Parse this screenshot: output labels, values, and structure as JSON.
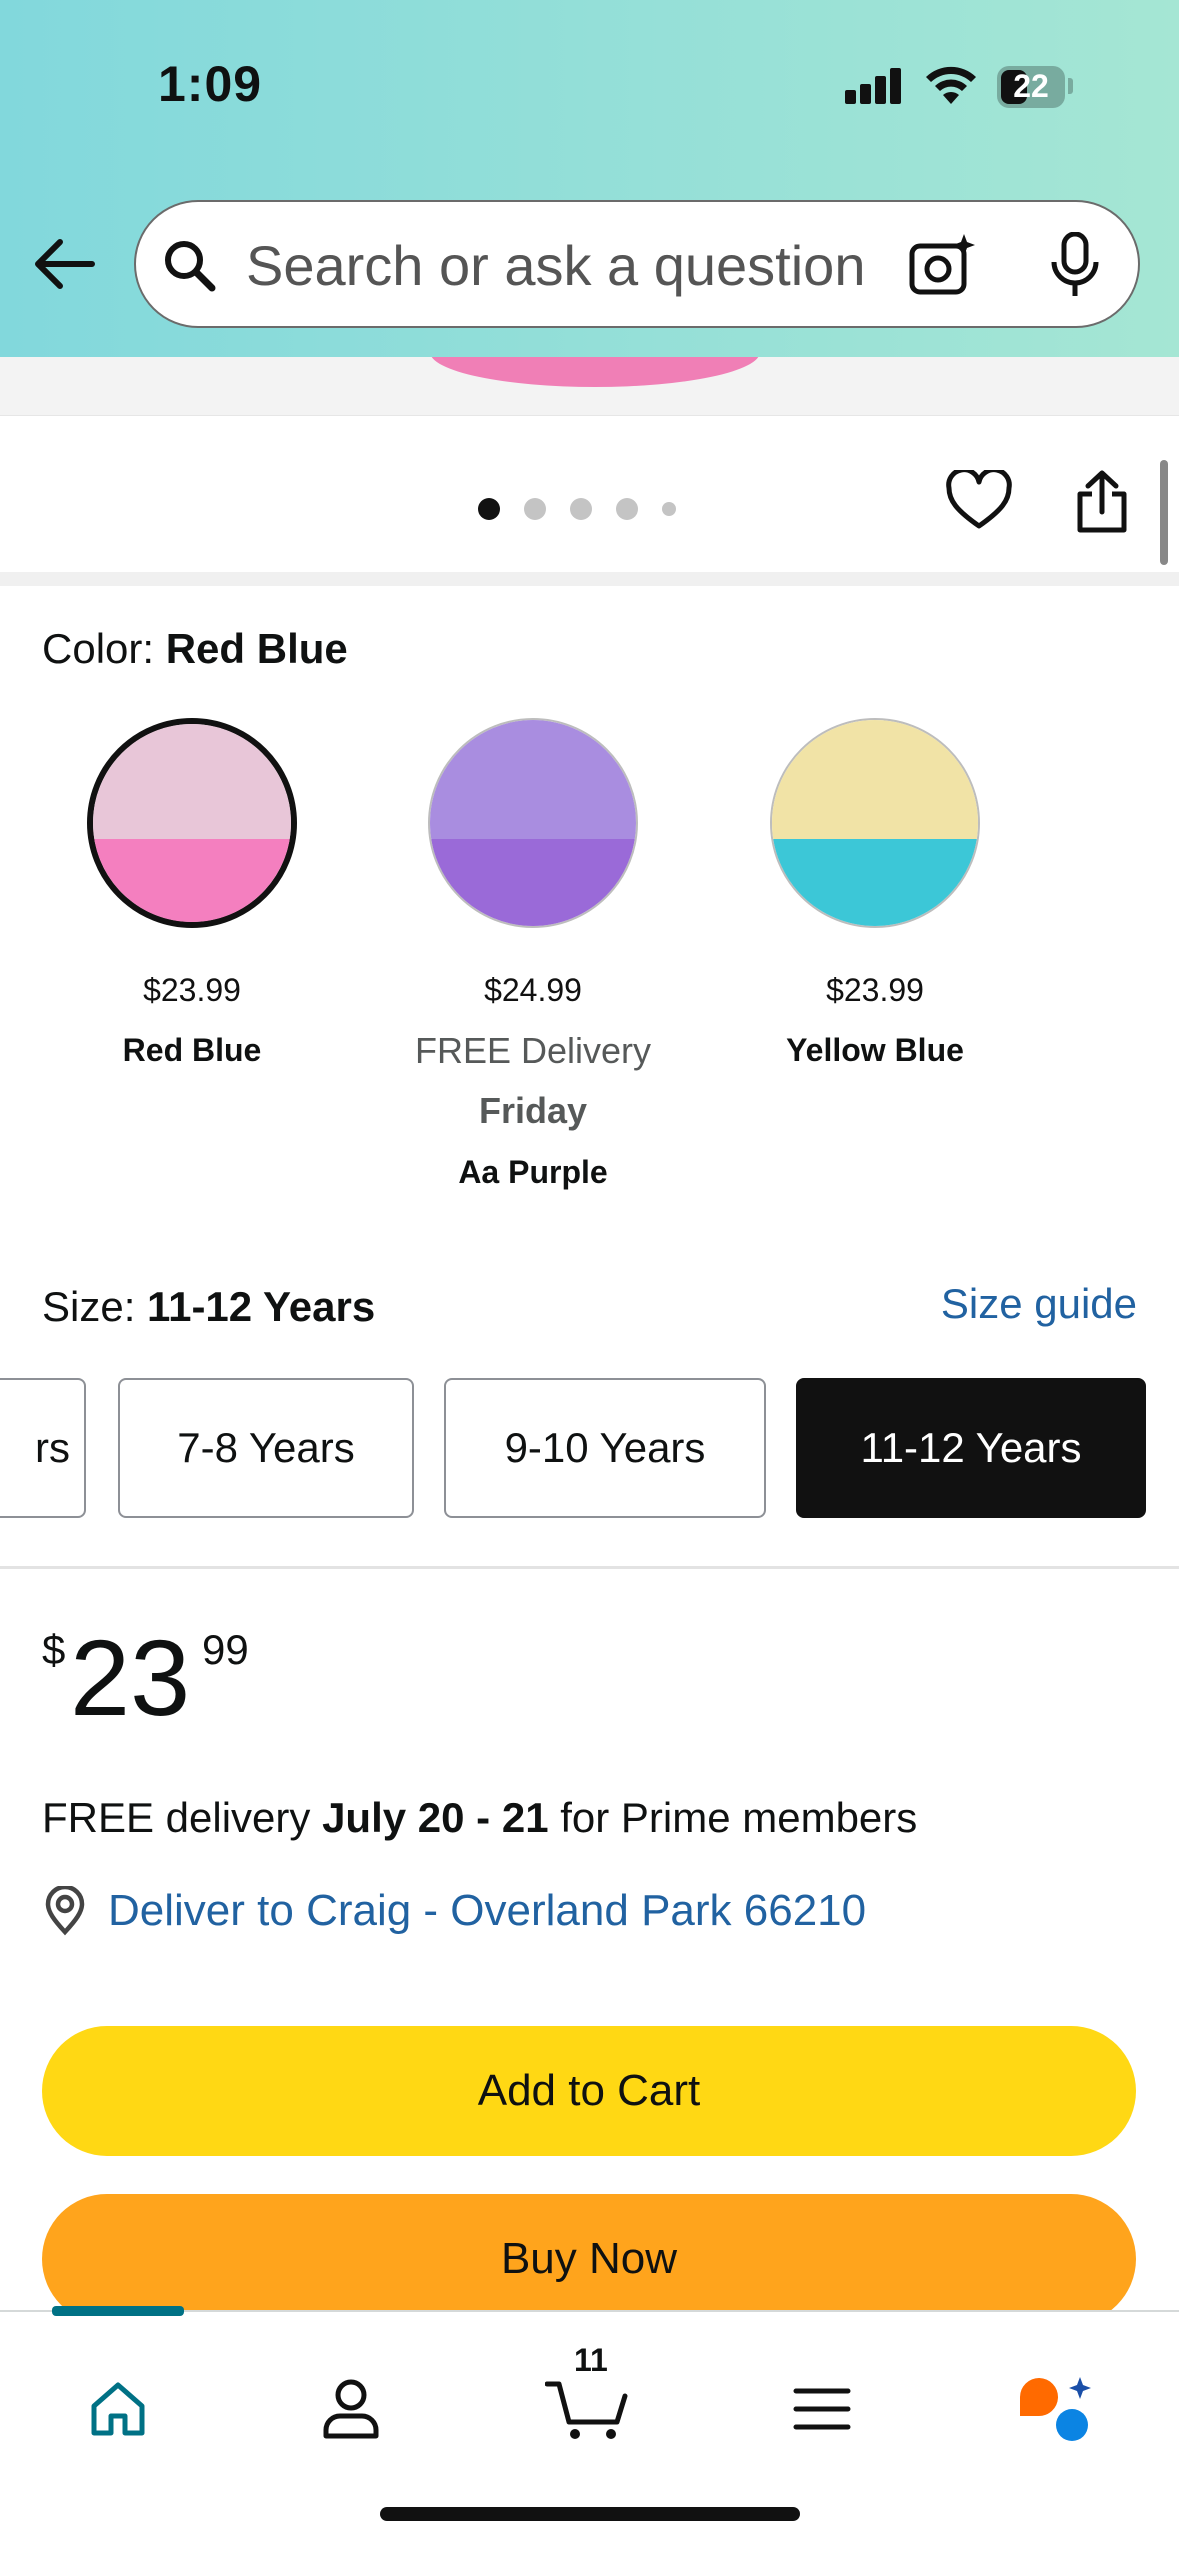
{
  "status_bar": {
    "time": "1:09",
    "battery": "22"
  },
  "search": {
    "placeholder": "Search or ask a question"
  },
  "carousel": {
    "dot_count": 5,
    "active_index": 0
  },
  "color": {
    "label": "Color:",
    "selected": "Red Blue",
    "variants": [
      {
        "price": "$23.99",
        "name": "Red Blue",
        "selected": true,
        "top_color": "#e8c6d8",
        "bottom_color": "#f47fbf"
      },
      {
        "price": "$24.99",
        "delivery": "FREE Delivery",
        "delivery_day": "Friday",
        "name": "Aa Purple",
        "selected": false,
        "top_color": "#a98de0",
        "bottom_color": "#9a6ad8"
      },
      {
        "price": "$23.99",
        "name": "Yellow Blue",
        "selected": false,
        "top_color": "#f1e3a6",
        "bottom_color": "#3cc7d7"
      }
    ]
  },
  "size": {
    "label": "Size:",
    "selected": "11-12 Years",
    "guide_link": "Size guide",
    "options": [
      {
        "label": "rs",
        "selected": false
      },
      {
        "label": "7-8 Years",
        "selected": false
      },
      {
        "label": "9-10 Years",
        "selected": false
      },
      {
        "label": "11-12 Years",
        "selected": true
      }
    ]
  },
  "price": {
    "symbol": "$",
    "whole": "23",
    "fraction": "99"
  },
  "delivery": {
    "prefix": "FREE delivery",
    "dates": "July 20 - 21",
    "suffix": "for Prime members",
    "deliver_to": "Deliver to Craig - Overland Park 66210"
  },
  "buttons": {
    "add_to_cart": "Add to Cart",
    "buy_now": "Buy Now"
  },
  "nav": {
    "cart_count": "11",
    "accent": "#007185"
  }
}
